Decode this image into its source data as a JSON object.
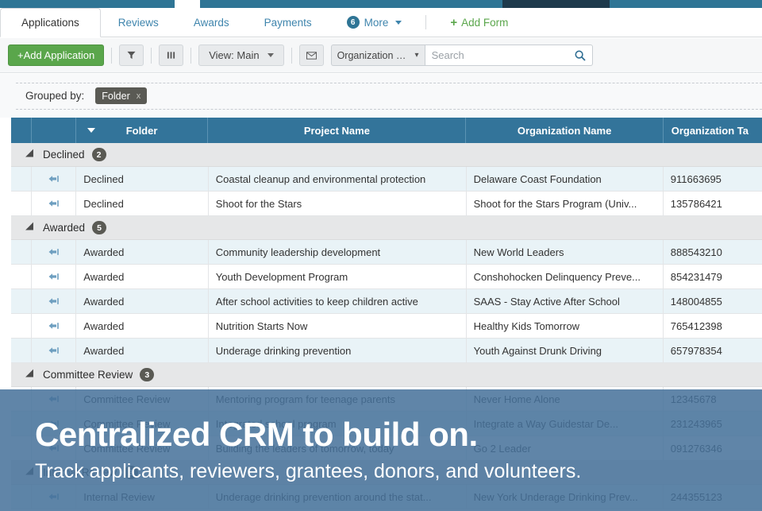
{
  "topbar": {
    "accent_color": "#2f7595",
    "dark_color": "#1e3a4c"
  },
  "tabs": [
    {
      "label": "Applications",
      "active": true
    },
    {
      "label": "Reviews",
      "active": false
    },
    {
      "label": "Awards",
      "active": false
    },
    {
      "label": "Payments",
      "active": false
    }
  ],
  "more": {
    "count": "6",
    "label": "More"
  },
  "add_form": {
    "label": "Add Form",
    "plus": "+"
  },
  "toolbar": {
    "add_application": "+Add Application",
    "filter_icon_title": "Filter",
    "columns_icon_title": "Columns",
    "view_label": "View: Main",
    "email_icon_title": "Email",
    "search_scope": "Organization N...",
    "search_placeholder": "Search"
  },
  "grouping": {
    "label": "Grouped by:",
    "chip": "Folder",
    "chip_remove": "x"
  },
  "grid": {
    "columns": [
      "",
      "",
      "Folder",
      "Project Name",
      "Organization Name",
      "Organization Ta"
    ],
    "groups": [
      {
        "name": "Declined",
        "count": "2",
        "rows": [
          {
            "folder": "Declined",
            "project": "Coastal cleanup and environmental protection",
            "org": "Delaware Coast Foundation",
            "tax": "911663695"
          },
          {
            "folder": "Declined",
            "project": "Shoot for the Stars",
            "org": "Shoot for the Stars Program (Univ...",
            "tax": "135786421"
          }
        ]
      },
      {
        "name": "Awarded",
        "count": "5",
        "rows": [
          {
            "folder": "Awarded",
            "project": "Community leadership development",
            "org": "New World Leaders",
            "tax": "888543210"
          },
          {
            "folder": "Awarded",
            "project": "Youth Development Program",
            "org": "Conshohocken Delinquency Preve...",
            "tax": "854231479"
          },
          {
            "folder": "Awarded",
            "project": "After school activities to keep children active",
            "org": "SAAS - Stay Active After School",
            "tax": "148004855"
          },
          {
            "folder": "Awarded",
            "project": "Nutrition Starts Now",
            "org": "Healthy Kids Tomorrow",
            "tax": "765412398"
          },
          {
            "folder": "Awarded",
            "project": "Underage drinking prevention",
            "org": "Youth Against Drunk Driving",
            "tax": "657978354"
          }
        ]
      },
      {
        "name": "Committee Review",
        "count": "3",
        "rows": [
          {
            "folder": "Committee Review",
            "project": "Mentoring program for teenage parents",
            "org": "Never Home Alone",
            "tax": "12345678"
          },
          {
            "folder": "Committee Review",
            "project": "Integrated school program",
            "org": "Integrate a Way Guidestar De...",
            "tax": "231243965"
          },
          {
            "folder": "Committee Review",
            "project": "Building the leaders of tomorrow, today",
            "org": "Go 2 Leader",
            "tax": "091276346"
          }
        ]
      },
      {
        "name": "Internal Review",
        "count": "3",
        "rows": [
          {
            "folder": "Internal Review",
            "project": "Underage drinking prevention around the stat...",
            "org": "New York Underage Drinking Prev...",
            "tax": "244355123"
          }
        ]
      }
    ],
    "row_icon": "reply-arrow-icon"
  },
  "overlay": {
    "title": "Centralized CRM to build on.",
    "subtitle": "Track applicants, reviewers, grantees, donors, and volunteers.",
    "background_color": "#46719a"
  }
}
